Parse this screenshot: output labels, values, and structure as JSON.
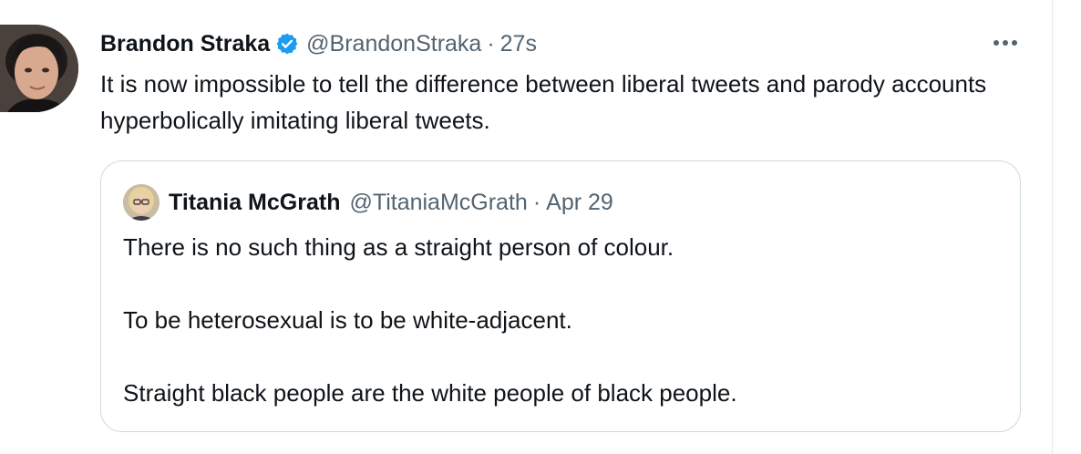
{
  "tweet": {
    "author_name": "Brandon Straka",
    "author_handle": "@BrandonStraka",
    "separator": "·",
    "timestamp": "27s",
    "text": "It is now impossible to tell the difference between liberal tweets and parody accounts hyperbolically imitating liberal tweets.",
    "verified": true,
    "icons": {
      "verified": "verified-badge-icon",
      "more": "more-options-icon"
    }
  },
  "quoted_tweet": {
    "author_name": "Titania McGrath",
    "author_handle": "@TitaniaMcGrath",
    "separator": "·",
    "date": "Apr 29",
    "lines": [
      "There is no such thing as a straight person of colour.",
      "To be heterosexual is to be white-adjacent.",
      "Straight black people are the white people of black people."
    ]
  },
  "colors": {
    "text_primary": "#0f1419",
    "text_secondary": "#536471",
    "verified_blue": "#1d9bf0",
    "border": "#cfd9de"
  }
}
